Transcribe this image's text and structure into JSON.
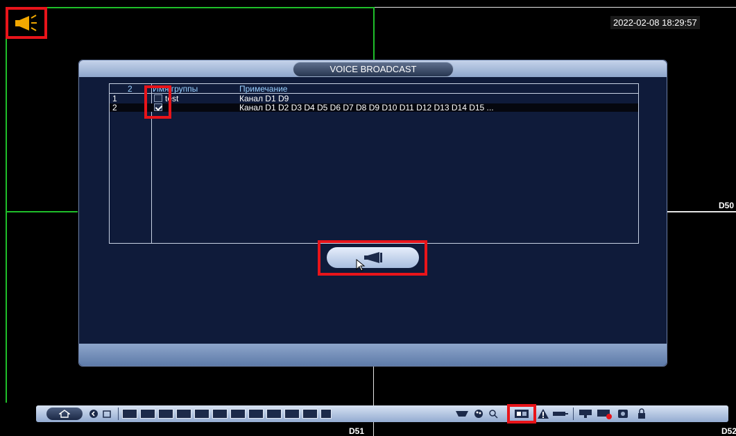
{
  "screen": {
    "datetime": "2022-02-08 18:29:57",
    "camera_labels": [
      "D50",
      "D51",
      "D52"
    ]
  },
  "dialog": {
    "title": "VOICE BROADCAST",
    "columns": {
      "count": "2",
      "name": "Имя группы",
      "note": "Примечание"
    },
    "rows": [
      {
        "num": "1",
        "checked": false,
        "name": "test",
        "note": "Канал  D1  D9"
      },
      {
        "num": "2",
        "checked": true,
        "name": "",
        "note": "Канал  D1  D2  D3  D4  D5  D6  D7  D8  D9  D10  D11  D12  D13  D14  D15 ..."
      }
    ],
    "broadcast_button_icon": "megaphone-icon"
  },
  "toolbar": {
    "icons": [
      "home-icon",
      "back-icon",
      "window-icon",
      "split-1-icon",
      "split-4-icon",
      "split-6-icon",
      "split-8-icon",
      "split-9-icon",
      "split-13-icon",
      "split-16-icon",
      "split-25-icon",
      "split-36-icon",
      "prev-screen-icon",
      "next-screen-icon",
      "tour-icon",
      "ptz-icon",
      "color-icon",
      "search-icon",
      "broadcast-icon",
      "alarm-icon",
      "remote-device-icon",
      "network-icon",
      "hdd-icon",
      "disk-icon",
      "lock-icon"
    ]
  },
  "colors": {
    "highlight": "#e8141a",
    "grid_active": "#1fbf2a",
    "dialog_bg": "#0f1b3a",
    "accent_yellow": "#f2a800"
  }
}
